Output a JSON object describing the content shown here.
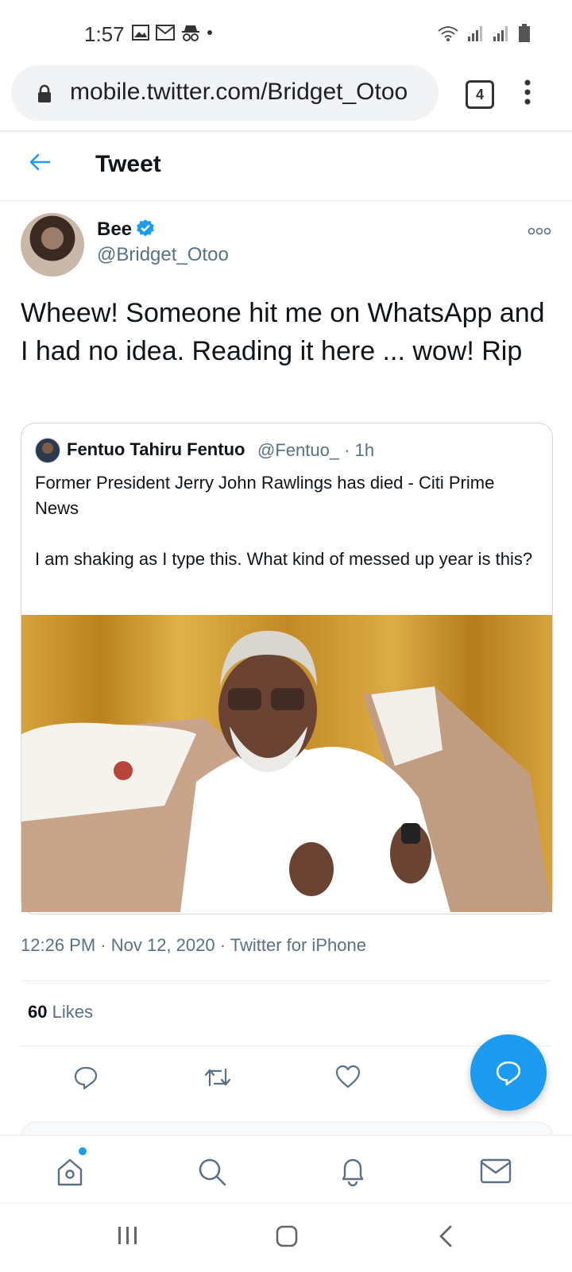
{
  "status_bar": {
    "time": "1:57"
  },
  "browser": {
    "url": "mobile.twitter.com/Bridget_Otoo",
    "tab_count": "4"
  },
  "header": {
    "title": "Tweet"
  },
  "tweet": {
    "author_name": "Bee",
    "author_handle": "@Bridget_Otoo",
    "text": "Wheew! Someone hit me on WhatsApp and I had no idea. Reading it here ... wow! Rip",
    "meta": "12:26 PM · Nov 12, 2020 · Twitter for iPhone",
    "likes_count": "60",
    "likes_label": "Likes"
  },
  "quoted_tweet": {
    "author_name": "Fentuo Tahiru Fentuo",
    "author_handle_time": "@Fentuo_ · 1h",
    "text": "Former President Jerry John Rawlings has died - Citi Prime News\n\nI am shaking as I type this. What kind of messed up year is this?"
  },
  "colors": {
    "accent": "#1d9bf0",
    "secondary_text": "#5b7083",
    "border": "#cfd9de"
  },
  "icons": {
    "back": "back-arrow-icon",
    "verified": "verified-badge-icon",
    "more": "more-options-icon",
    "reply": "reply-icon",
    "retweet": "retweet-icon",
    "like": "like-icon",
    "compose": "compose-reply-icon",
    "home": "home-icon",
    "search": "search-icon",
    "notifications": "bell-icon",
    "messages": "mail-icon"
  }
}
